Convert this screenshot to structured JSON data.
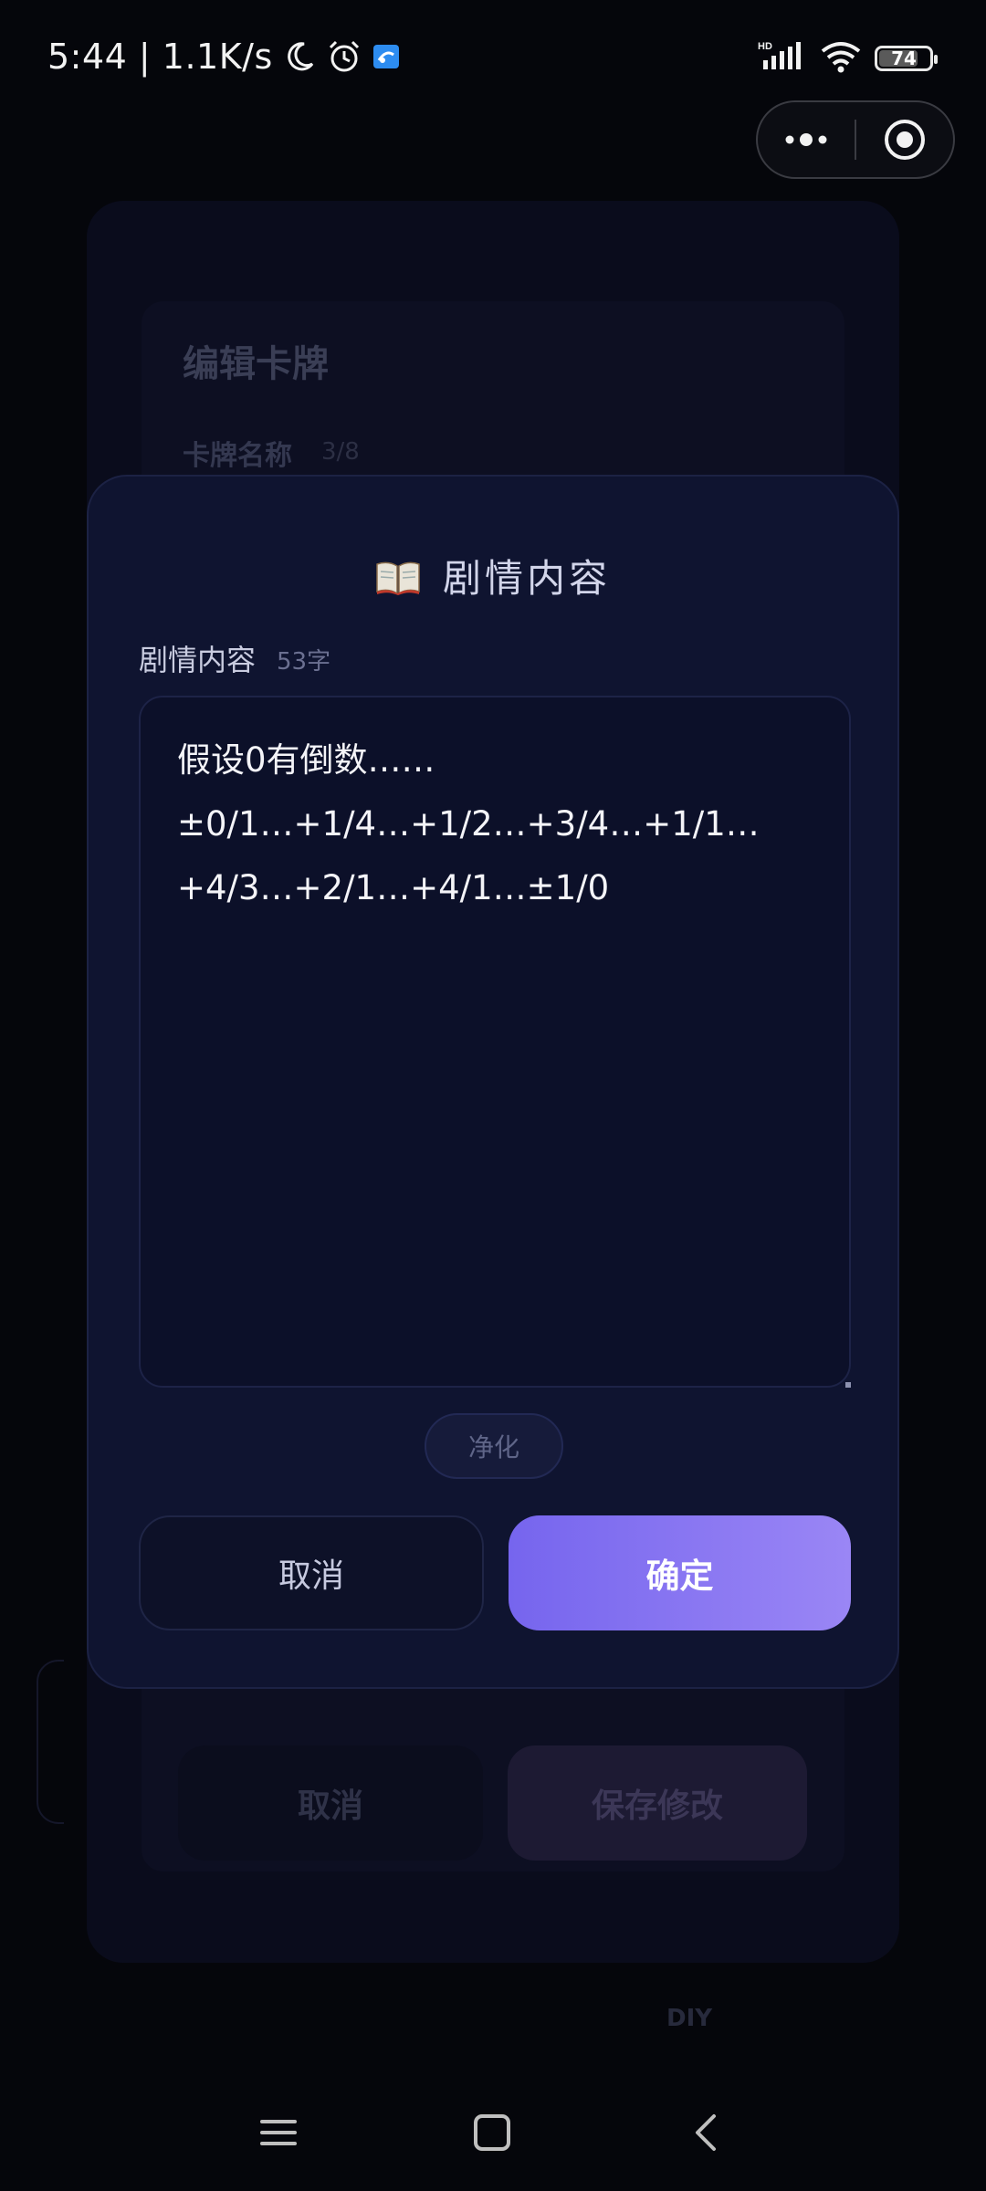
{
  "status_bar": {
    "time_speed": "5:44 | 1.1K/s",
    "network_label": "HD",
    "battery_level": "74"
  },
  "background": {
    "title": "编辑卡牌",
    "card_name_label": "卡牌名称",
    "card_name_count": "3/8",
    "cancel_label": "取消",
    "save_label": "保存修改",
    "tab_label": "DIY"
  },
  "modal": {
    "title": "剧情内容",
    "field_label": "剧情内容",
    "char_count": "53字",
    "content": "假设0有倒数……\n±0/1…+1/4…+1/2…+3/4…+1/1…\n+4/3…+2/1…+4/1…±1/0",
    "purify_label": "净化",
    "cancel_label": "取消",
    "confirm_label": "确定"
  },
  "colors": {
    "accent_start": "#7665ee",
    "accent_end": "#9a86f5",
    "modal_bg": "#0f1430"
  }
}
